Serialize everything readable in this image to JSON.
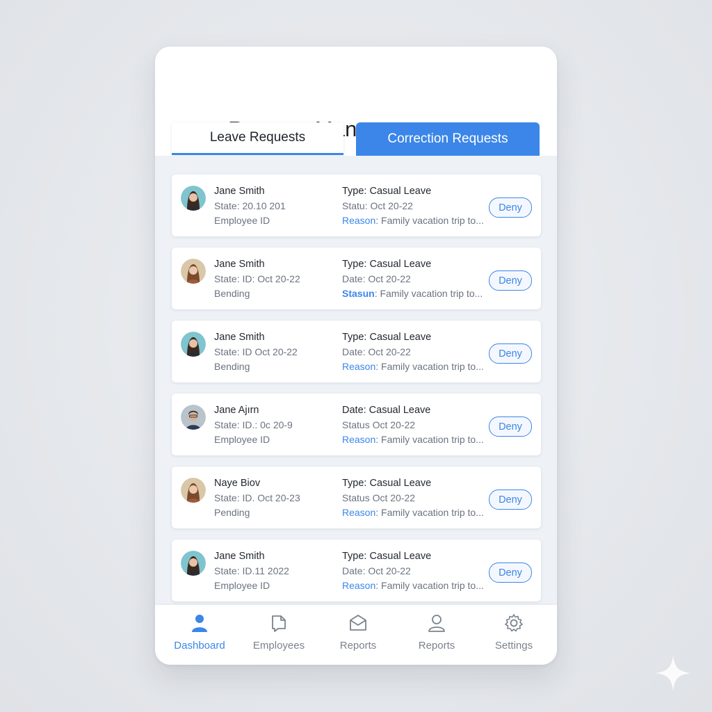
{
  "header": {
    "title": "Request Management"
  },
  "tabs": [
    {
      "label": "Leave Requests",
      "active": false
    },
    {
      "label": "Correction Requests",
      "active": true
    }
  ],
  "requests": [
    {
      "name": "Jane Smith",
      "line2": "State: 20.10 201",
      "line3": "Employee ID",
      "type": "Type: Casual Leave",
      "date": "Statu: Oct 20-22",
      "reason_label": "Reason",
      "reason_text": ": Family vacation trip to...",
      "action": "Deny",
      "avatar": "woman-teal"
    },
    {
      "name": "Jane Smith",
      "line2": "State: ID: Oct 20-22",
      "line3": "Bending",
      "type": "Type: Casual Leave",
      "date": "Date:  Oct 20-22",
      "reason_label": "Stasun",
      "reason_text": ": Family vacation trip to...",
      "action": "Deny",
      "avatar": "woman-beige"
    },
    {
      "name": "Jane Smith",
      "line2": "State: ID  Oct 20-22",
      "line3": "Bending",
      "type": "Type: Casual Leave",
      "date": "Date:  Oct 20-22",
      "reason_label": "Reason",
      "reason_text": ": Family vacation trip to...",
      "action": "Deny",
      "avatar": "woman-teal"
    },
    {
      "name": "Jane Ajırn",
      "line2": "State: ID.: 0c 20-9",
      "line3": "Employee ID",
      "type": "Date: Casual Leave",
      "date": "Status Oct 20-22",
      "reason_label": "Reason",
      "reason_text": ": Family vacation trip to...",
      "action": "Deny",
      "avatar": "man-glasses"
    },
    {
      "name": "Naye Biov",
      "line2": "State: ID. Oct 20-23",
      "line3": "Pending",
      "type": "Type: Casual Leave",
      "date": "Status Oct 20-22",
      "reason_label": "Reason",
      "reason_text": ": Family vacation trip to...",
      "action": "Deny",
      "avatar": "woman-beige"
    },
    {
      "name": "Jane Smith",
      "line2": "State: ID.11 2022",
      "line3": "Employee ID",
      "type": "Type: Casual Leave",
      "date": "Date:  Oct 20-22",
      "reason_label": "Reason",
      "reason_text": ": Family vacation trip to...",
      "action": "Deny",
      "avatar": "woman-teal"
    }
  ],
  "nav": [
    {
      "label": "Dashboard",
      "icon": "person-icon",
      "active": true
    },
    {
      "label": "Employees",
      "icon": "document-icon",
      "active": false
    },
    {
      "label": "Reports",
      "icon": "mail-icon",
      "active": false
    },
    {
      "label": "Reports",
      "icon": "user-outline-icon",
      "active": false
    },
    {
      "label": "Settings",
      "icon": "gear-icon",
      "active": false
    }
  ],
  "colors": {
    "accent": "#3b86e8",
    "background": "#eef2f7"
  }
}
